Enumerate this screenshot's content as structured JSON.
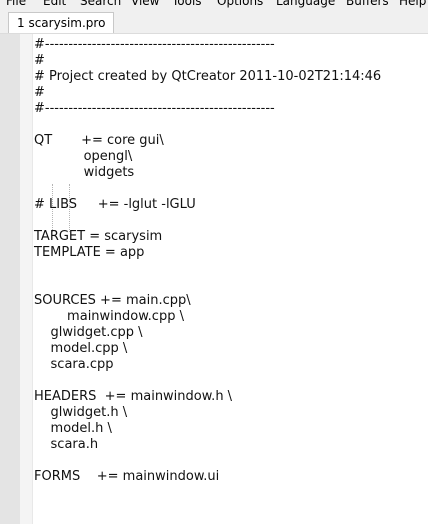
{
  "menu": [
    "File",
    "Edit",
    "Search",
    "View",
    "Tools",
    "Options",
    "Language",
    "Buffers",
    "Help"
  ],
  "tab": {
    "label": "1 scarysim.pro"
  },
  "lines": [
    "#-------------------------------------------------",
    "#",
    "# Project created by QtCreator 2011-10-02T21:14:46",
    "#",
    "#-------------------------------------------------",
    "",
    "QT       += core gui\\",
    "            opengl\\",
    "            widgets",
    "",
    "# LIBS     += -lglut -lGLU",
    "",
    "TARGET = scarysim",
    "TEMPLATE = app",
    "",
    "",
    "SOURCES += main.cpp\\",
    "        mainwindow.cpp \\",
    "    glwidget.cpp \\",
    "    model.cpp \\",
    "    scara.cpp",
    "",
    "HEADERS  += mainwindow.h \\",
    "    glwidget.h \\",
    "    model.h \\",
    "    scara.h",
    "",
    "FORMS    += mainwindow.ui"
  ]
}
